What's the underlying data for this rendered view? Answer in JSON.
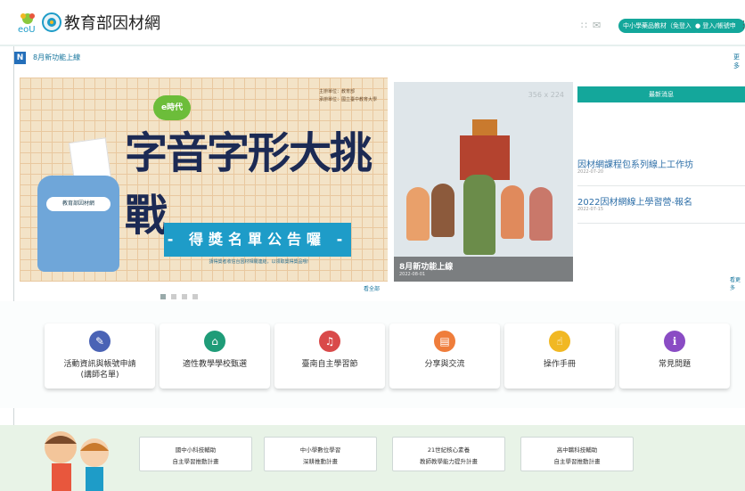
{
  "header": {
    "logo_text": "eoU",
    "site_title": "教育部因材網",
    "icons": [
      "grid-icon",
      "mail-icon"
    ],
    "trial_button": "中小學藥品教材（免登入）",
    "login_button": "登入/帳號申請",
    "menu_icon": "menu-icon"
  },
  "announcement": {
    "badge": "N",
    "text": "8月新功能上線",
    "more": "更多"
  },
  "banner": {
    "small_text_1": "主辦單位：教育部",
    "small_text_2": "承辦單位：國立臺中教育大學",
    "e_badge": "e時代",
    "title": "字音字形大挑戰",
    "backpack_tag": "教育部因材網",
    "ribbon": "- 得獎名單公告囉 -",
    "subtitle": "請得獎者收信台因材相關連結，以領取獎得獎品哦！",
    "all_link": "看全部"
  },
  "news_card": {
    "size_label": "356 x 224",
    "title": "8月新功能上線",
    "date": "2022-08-01"
  },
  "latest": {
    "heading": "最新消息",
    "items": [
      {
        "title": "因材網課程包系列線上工作坊",
        "date": "2022-07-20"
      },
      {
        "title": "2022因材網線上學習營-報名",
        "date": "2022-07-15"
      }
    ],
    "more": "看更多"
  },
  "shortcuts": [
    {
      "label1": "活動資訊與帳號申請",
      "label2": "(講師名單)",
      "icon": "edit-icon",
      "color": "#4a63b5"
    },
    {
      "label1": "適性教學學校甄選",
      "label2": "",
      "icon": "school-icon",
      "color": "#1f9c78"
    },
    {
      "label1": "臺南自主學習節",
      "label2": "",
      "icon": "music-icon",
      "color": "#d94a4a"
    },
    {
      "label1": "分享與交流",
      "label2": "",
      "icon": "chat-icon",
      "color": "#ef7d3b"
    },
    {
      "label1": "操作手冊",
      "label2": "",
      "icon": "hand-icon",
      "color": "#f1b823"
    },
    {
      "label1": "常見問題",
      "label2": "",
      "icon": "info-icon",
      "color": "#8a4cc4"
    }
  ],
  "programs": [
    {
      "line1": "國中小科技輔助",
      "line2": "自主學習推動計畫"
    },
    {
      "line1": "中小學數位學習",
      "line2": "深耕推動計畫"
    },
    {
      "line1": "21世紀核心素養",
      "line2": "教師教學能力提升計畫"
    },
    {
      "line1": "高中職科技輔助",
      "line2": "自主學習推動計畫"
    }
  ]
}
